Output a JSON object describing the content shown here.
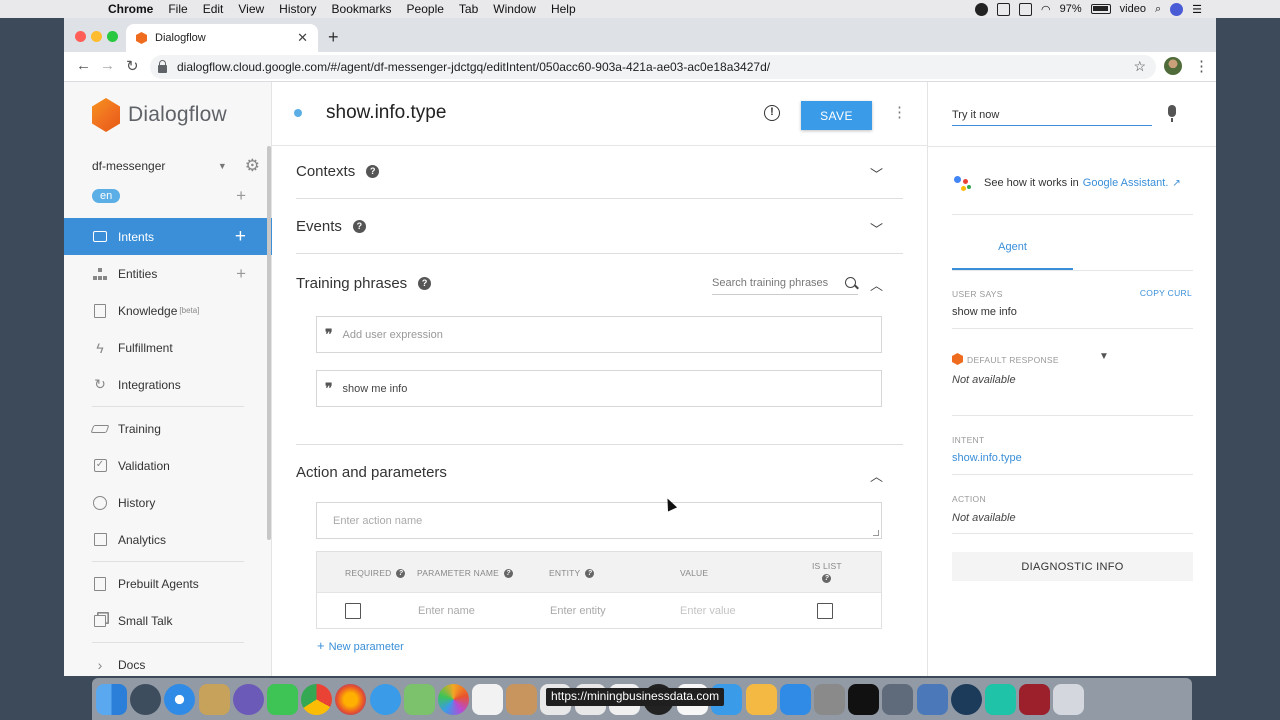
{
  "menubar": {
    "app": "Chrome",
    "items": [
      "File",
      "Edit",
      "View",
      "History",
      "Bookmarks",
      "People",
      "Tab",
      "Window",
      "Help"
    ],
    "battery": "97%",
    "user": "video"
  },
  "browser": {
    "tab_title": "Dialogflow",
    "url": "dialogflow.cloud.google.com/#/agent/df-messenger-jdctgq/editIntent/050acc60-903a-421a-ae03-ac0e18a3427d/"
  },
  "sidebar": {
    "logo_text": "Dialogflow",
    "agent_name": "df-messenger",
    "language": "en",
    "items": [
      {
        "label": "Intents"
      },
      {
        "label": "Entities"
      },
      {
        "label": "Knowledge",
        "badge": "[beta]"
      },
      {
        "label": "Fulfillment"
      },
      {
        "label": "Integrations"
      },
      {
        "label": "Training"
      },
      {
        "label": "Validation"
      },
      {
        "label": "History"
      },
      {
        "label": "Analytics"
      },
      {
        "label": "Prebuilt Agents"
      },
      {
        "label": "Small Talk"
      },
      {
        "label": "Docs"
      }
    ]
  },
  "intent": {
    "name": "show.info.type",
    "save_label": "SAVE",
    "sections": {
      "contexts": "Contexts",
      "events": "Events",
      "training": "Training phrases",
      "action": "Action and parameters"
    },
    "search_placeholder": "Search training phrases",
    "add_expression_placeholder": "Add user expression",
    "phrases": [
      "show me info"
    ],
    "action_placeholder": "Enter action name",
    "param_headers": {
      "required": "REQUIRED",
      "name": "PARAMETER NAME",
      "entity": "ENTITY",
      "value": "VALUE",
      "is_list": "IS LIST"
    },
    "param_placeholders": {
      "name": "Enter name",
      "entity": "Enter entity",
      "value": "Enter value"
    },
    "new_parameter": "New parameter"
  },
  "console": {
    "try_placeholder": "Try it now",
    "ga_text": "See how it works in",
    "ga_link": "Google Assistant.",
    "tab": "Agent",
    "user_says_label": "USER SAYS",
    "copy_curl": "COPY CURL",
    "user_says": "show me info",
    "default_response_label": "DEFAULT RESPONSE",
    "default_response": "Not available",
    "intent_label": "INTENT",
    "intent_value": "show.info.type",
    "action_label": "ACTION",
    "action_value": "Not available",
    "diagnostic_label": "DIAGNOSTIC INFO"
  },
  "dock": {
    "tooltip": "https://miningbusinessdata.com"
  },
  "colors": {
    "accent": "#3a8fd8",
    "save_button": "#3a9be8",
    "brand_orange": "#ef6c1f"
  }
}
